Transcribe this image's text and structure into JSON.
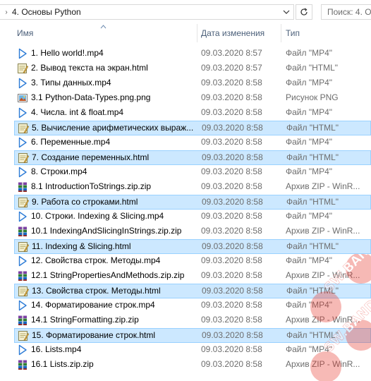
{
  "address": {
    "path": "4. Основы Python",
    "search_placeholder": "Поиск: 4. О"
  },
  "columns": {
    "name": "Имя",
    "date": "Дата изменения",
    "type": "Тип"
  },
  "files": [
    {
      "name": "1. Hello world!.mp4",
      "date": "09.03.2020 8:57",
      "type": "Файл \"MP4\"",
      "icon": "video-icon",
      "selected": false
    },
    {
      "name": "2. Вывод текста на экран.html",
      "date": "09.03.2020 8:57",
      "type": "Файл \"HTML\"",
      "icon": "html-file-icon",
      "selected": false
    },
    {
      "name": "3. Типы данных.mp4",
      "date": "09.03.2020 8:58",
      "type": "Файл \"MP4\"",
      "icon": "video-icon",
      "selected": false
    },
    {
      "name": "3.1 Python-Data-Types.png.png",
      "date": "09.03.2020 8:58",
      "type": "Рисунок PNG",
      "icon": "image-file-icon",
      "selected": false
    },
    {
      "name": "4. Числа. int & float.mp4",
      "date": "09.03.2020 8:58",
      "type": "Файл \"MP4\"",
      "icon": "video-icon",
      "selected": false
    },
    {
      "name": "5. Вычисление арифметических выраж...",
      "date": "09.03.2020 8:58",
      "type": "Файл \"HTML\"",
      "icon": "html-file-icon",
      "selected": true
    },
    {
      "name": "6. Переменные.mp4",
      "date": "09.03.2020 8:58",
      "type": "Файл \"MP4\"",
      "icon": "video-icon",
      "selected": false
    },
    {
      "name": "7. Создание переменных.html",
      "date": "09.03.2020 8:58",
      "type": "Файл \"HTML\"",
      "icon": "html-file-icon",
      "selected": true
    },
    {
      "name": "8. Строки.mp4",
      "date": "09.03.2020 8:58",
      "type": "Файл \"MP4\"",
      "icon": "video-icon",
      "selected": false
    },
    {
      "name": "8.1 IntroductionToStrings.zip.zip",
      "date": "09.03.2020 8:58",
      "type": "Архив ZIP - WinR...",
      "icon": "zip-archive-icon",
      "selected": false
    },
    {
      "name": "9. Работа со строками.html",
      "date": "09.03.2020 8:58",
      "type": "Файл \"HTML\"",
      "icon": "html-file-icon",
      "selected": true
    },
    {
      "name": "10. Строки. Indexing & Slicing.mp4",
      "date": "09.03.2020 8:58",
      "type": "Файл \"MP4\"",
      "icon": "video-icon",
      "selected": false
    },
    {
      "name": "10.1 IndexingAndSlicingInStrings.zip.zip",
      "date": "09.03.2020 8:58",
      "type": "Архив ZIP - WinR...",
      "icon": "zip-archive-icon",
      "selected": false
    },
    {
      "name": "11. Indexing & Slicing.html",
      "date": "09.03.2020 8:58",
      "type": "Файл \"HTML\"",
      "icon": "html-file-icon",
      "selected": true
    },
    {
      "name": "12. Свойства строк. Методы.mp4",
      "date": "09.03.2020 8:58",
      "type": "Файл \"MP4\"",
      "icon": "video-icon",
      "selected": false
    },
    {
      "name": "12.1 StringPropertiesAndMethods.zip.zip",
      "date": "09.03.2020 8:58",
      "type": "Архив ZIP - WinR...",
      "icon": "zip-archive-icon",
      "selected": false
    },
    {
      "name": "13. Свойства строк. Методы.html",
      "date": "09.03.2020 8:58",
      "type": "Файл \"HTML\"",
      "icon": "html-file-icon",
      "selected": true
    },
    {
      "name": "14. Форматирование строк.mp4",
      "date": "09.03.2020 8:58",
      "type": "Файл \"MP4\"",
      "icon": "video-icon",
      "selected": false
    },
    {
      "name": "14.1 StringFormatting.zip.zip",
      "date": "09.03.2020 8:58",
      "type": "Архив ZIP - WinR...",
      "icon": "zip-archive-icon",
      "selected": false
    },
    {
      "name": "15. Форматирование строк.html",
      "date": "09.03.2020 8:58",
      "type": "Файл \"HTML\"",
      "icon": "html-file-icon",
      "selected": true
    },
    {
      "name": "16. Lists.mp4",
      "date": "09.03.2020 8:58",
      "type": "Файл \"MP4\"",
      "icon": "video-icon",
      "selected": false
    },
    {
      "name": "16.1 Lists.zip.zip",
      "date": "09.03.2020 8:58",
      "type": "Архив ZIP - WinR...",
      "icon": "zip-archive-icon",
      "selected": false
    }
  ],
  "watermark": {
    "text": "SW.BAND"
  },
  "colors": {
    "selection_bg": "#cce8ff",
    "selection_border": "#99d1ff",
    "header_text": "#4c607a",
    "secondary_text": "#6d6d6d",
    "watermark": "#e8382f"
  }
}
